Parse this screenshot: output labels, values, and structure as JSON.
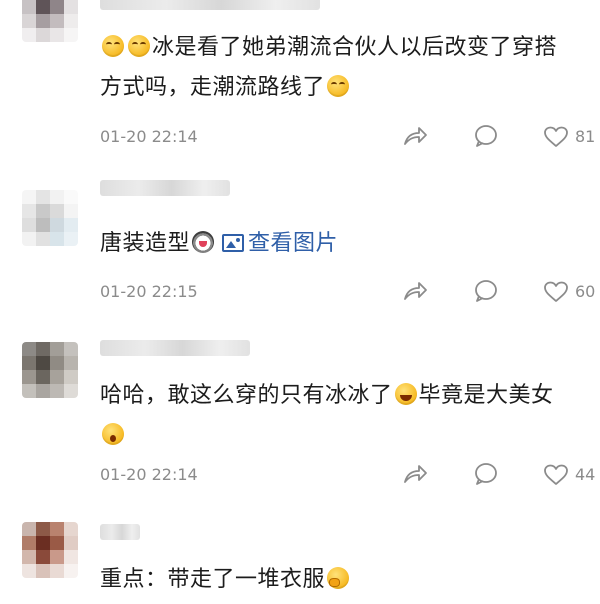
{
  "comments": [
    {
      "text_lines": [
        "冰是看了她弟潮流合伙人以后改变了穿搭",
        "方式吗，走潮流路线了"
      ],
      "time": "01-20 22:14",
      "likes": "81",
      "emojis": [
        "laugh-cry-emoji",
        "laugh-cry-emoji",
        "laugh-cry-emoji"
      ]
    },
    {
      "text": "唐装造型",
      "link_text": "查看图片",
      "time": "01-20 22:15",
      "likes": "60",
      "emojis": [
        "husky-emoji",
        "image-icon"
      ]
    },
    {
      "text_lines": [
        "哈哈，敢这么穿的只有冰冰了",
        "毕竟是大美女"
      ],
      "time": "01-20 22:14",
      "likes": "44",
      "emojis": [
        "laugh-emoji",
        "surprised-emoji"
      ]
    },
    {
      "text": "重点：带走了一堆衣服",
      "emojis": [
        "thinking-emoji"
      ]
    }
  ],
  "colors": {
    "link": "#2f5fa8",
    "meta": "#8b8b8b",
    "text": "#1c1c1c"
  }
}
